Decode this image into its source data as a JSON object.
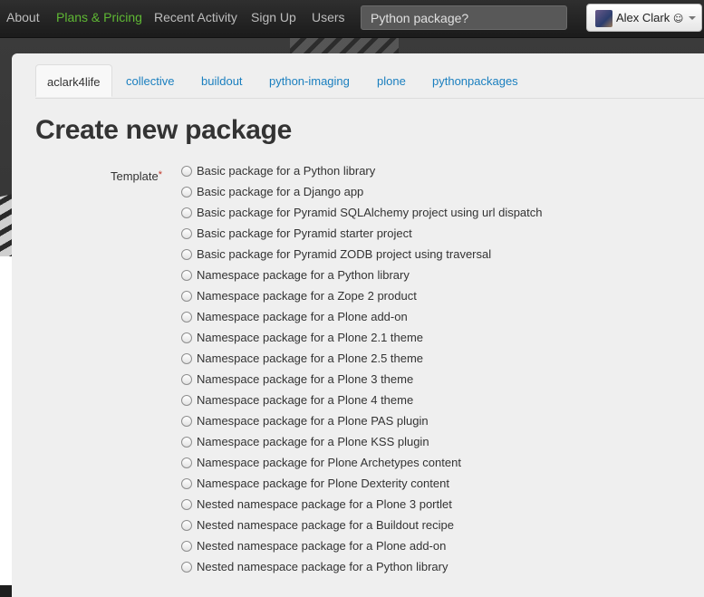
{
  "nav": {
    "links": [
      {
        "label": "About",
        "active": false
      },
      {
        "label": "Plans & Pricing",
        "active": true
      },
      {
        "label": "Recent Activity",
        "active": false
      },
      {
        "label": "Sign Up",
        "active": false
      },
      {
        "label": "Users",
        "active": false
      }
    ],
    "search_placeholder": "Python package?",
    "user": {
      "name": "Alex Clark",
      "emoji": "☺"
    }
  },
  "tabs": [
    {
      "label": "aclark4life",
      "active": true
    },
    {
      "label": "collective",
      "active": false
    },
    {
      "label": "buildout",
      "active": false
    },
    {
      "label": "python-imaging",
      "active": false
    },
    {
      "label": "plone",
      "active": false
    },
    {
      "label": "pythonpackages",
      "active": false
    }
  ],
  "page": {
    "title": "Create new package",
    "template_label": "Template",
    "required_marker": "*",
    "templates": [
      "Basic package for a Python library",
      "Basic package for a Django app",
      "Basic package for Pyramid SQLAlchemy project using url dispatch",
      "Basic package for Pyramid starter project",
      "Basic package for Pyramid ZODB project using traversal",
      "Namespace package for a Python library",
      "Namespace package for a Zope 2 product",
      "Namespace package for a Plone add-on",
      "Namespace package for a Plone 2.1 theme",
      "Namespace package for a Plone 2.5 theme",
      "Namespace package for a Plone 3 theme",
      "Namespace package for a Plone 4 theme",
      "Namespace package for a Plone PAS plugin",
      "Namespace package for a Plone KSS plugin",
      "Namespace package for Plone Archetypes content",
      "Namespace package for Plone Dexterity content",
      "Nested namespace package for a Plone 3 portlet",
      "Nested namespace package for a Buildout recipe",
      "Nested namespace package for a Plone add-on",
      "Nested namespace package for a Python library"
    ]
  },
  "colors": {
    "nav_active": "#5fb834",
    "link": "#1a7fbf",
    "required": "#c0392b"
  }
}
